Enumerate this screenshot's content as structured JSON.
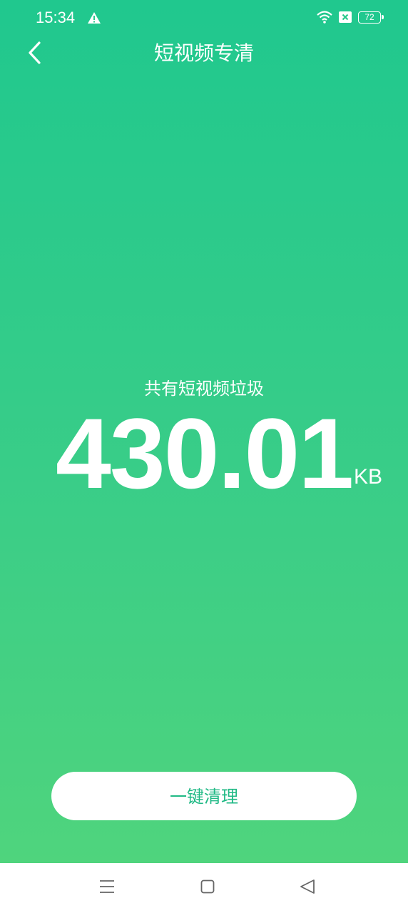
{
  "status_bar": {
    "time": "15:34",
    "battery": "72",
    "icons": [
      "warning-icon",
      "wifi-icon",
      "sim-error-icon",
      "battery-icon"
    ]
  },
  "header": {
    "title": "短视频专清",
    "back_icon": "chevron-left-icon"
  },
  "summary": {
    "label": "共有短视频垃圾",
    "value": "430.01",
    "unit": "KB"
  },
  "action": {
    "clean_label": "一键清理"
  },
  "nav_bar": {
    "icons": [
      "menu-icon",
      "home-icon",
      "back-triangle-icon"
    ]
  },
  "colors": {
    "gradient_top": "#20c88e",
    "gradient_bottom": "#4fd47d",
    "button_text": "#20b985",
    "nav_icon": "#666666"
  }
}
